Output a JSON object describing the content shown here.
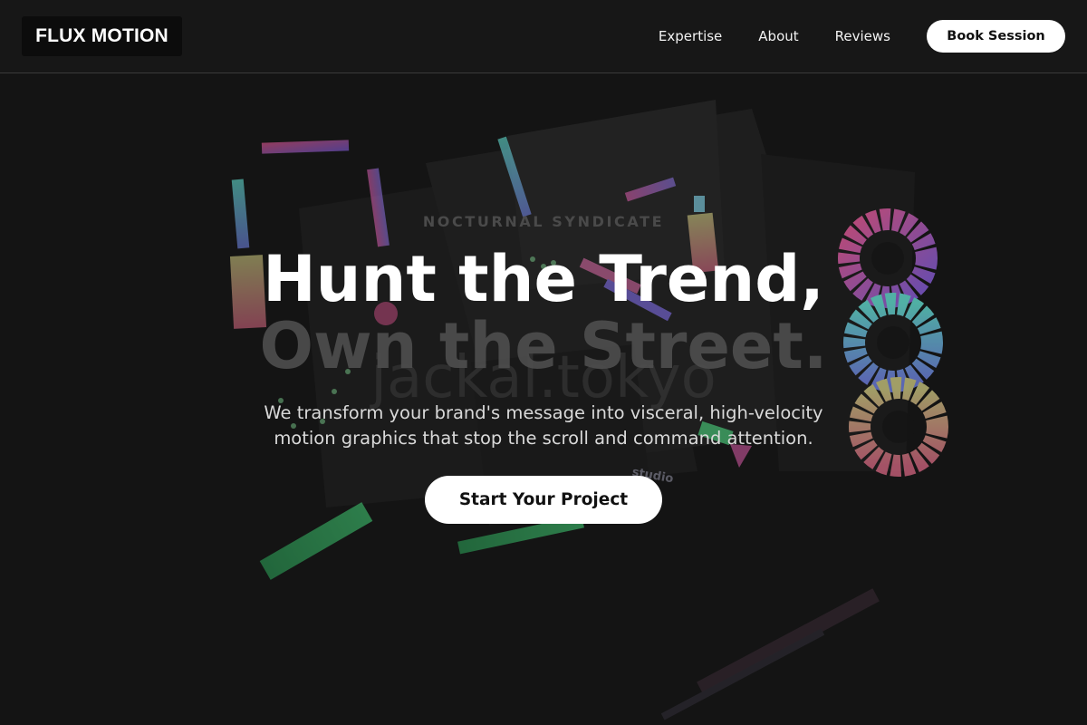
{
  "header": {
    "logo_text": "FLUX MOTION",
    "nav": [
      {
        "label": "Expertise"
      },
      {
        "label": "About"
      },
      {
        "label": "Reviews"
      }
    ],
    "book_label": "Book Session"
  },
  "hero": {
    "eyebrow": "NOCTURNAL SYNDICATE",
    "headline_line1": "Hunt the Trend,",
    "headline_line2": "Own the Street.",
    "background_word": "jackal.tokyo",
    "background_caption": "studio",
    "subtext": "We transform your brand's message into visceral, high-velocity motion graphics that stop the scroll and command attention.",
    "cta_label": "Start Your Project"
  },
  "colors": {
    "background": "#141414",
    "header_background": "#171717",
    "button_background": "#ffffff",
    "button_text": "#111111",
    "muted_text": "#4d4d4d"
  }
}
